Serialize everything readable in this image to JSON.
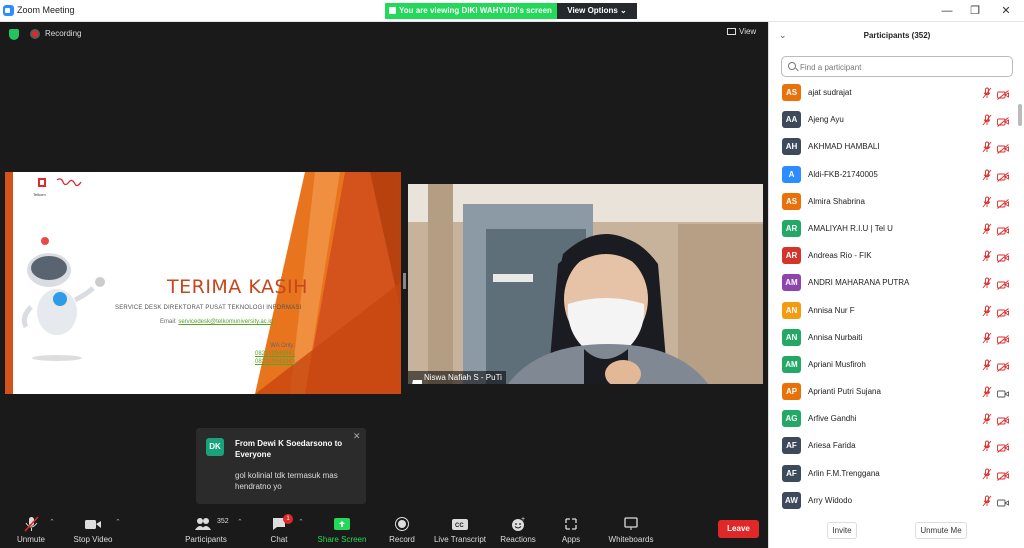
{
  "window": {
    "title": "Zoom Meeting",
    "viewing_banner": "You are viewing DIKI WAHYUDI's screen",
    "view_options": "View Options ⌄"
  },
  "meeting": {
    "recording_label": "Recording",
    "view_label": "View"
  },
  "slide": {
    "title": "TERIMA KASIH",
    "subtitle": "SERVICE DESK DIREKTORAT PUSAT TEKNOLOGI INFORMASI",
    "email_label": "Email:",
    "email": "servicedesk@telkomuniversity.ac.id",
    "wa_label": "WA Only:",
    "wa_numbers": [
      "082319949941",
      "082319949943"
    ],
    "logo_text_1": "Telkom University",
    "logo_text_2": "PuTI"
  },
  "webcam": {
    "name_label": "Niswa Nafiah S - PuTi"
  },
  "chat_toast": {
    "avatar_initials": "DK",
    "from": "From Dewi K Soedarsono to Everyone",
    "message": "gol kolinial tdk termasuk mas hendratno yo",
    "close": "✕"
  },
  "toolbar": {
    "unmute": "Unmute",
    "stop_video": "Stop Video",
    "participants": "Participants",
    "participants_count": "352",
    "chat": "Chat",
    "chat_badge": "1",
    "share_screen": "Share Screen",
    "record": "Record",
    "live_transcript": "Live Transcript",
    "reactions": "Reactions",
    "apps": "Apps",
    "whiteboards": "Whiteboards",
    "leave": "Leave"
  },
  "participants_panel": {
    "title": "Participants (352)",
    "search_placeholder": "Find a participant",
    "invite": "Invite",
    "unmute_me": "Unmute Me",
    "items": [
      {
        "initials": "AS",
        "name": "ajat sudrajat",
        "color": "#e8710a",
        "video_on": false
      },
      {
        "initials": "AA",
        "name": "Ajeng Ayu",
        "color": "#3d4a5c",
        "video_on": false
      },
      {
        "initials": "AH",
        "name": "AKHMAD HAMBALI",
        "color": "#3d4a5c",
        "video_on": false
      },
      {
        "initials": "A",
        "name": "Aldi-FKB-21740005",
        "color": "#2d8cff",
        "video_on": false
      },
      {
        "initials": "AS",
        "name": "Almira Shabrina",
        "color": "#e8710a",
        "video_on": false
      },
      {
        "initials": "AR",
        "name": "AMALIYAH R.I.U | Tel U",
        "color": "#23a866",
        "video_on": false
      },
      {
        "initials": "AR",
        "name": "Andreas Rio - FIK",
        "color": "#d4352b",
        "video_on": false
      },
      {
        "initials": "AM",
        "name": "ANDRI MAHARANA PUTRA",
        "color": "#8e44ad",
        "video_on": false
      },
      {
        "initials": "AN",
        "name": "Annisa Nur F",
        "color": "#f39c12",
        "video_on": false
      },
      {
        "initials": "AN",
        "name": "Annisa Nurbaiti",
        "color": "#23a866",
        "video_on": false
      },
      {
        "initials": "AM",
        "name": "Apriani Musfiroh",
        "color": "#23a866",
        "video_on": false
      },
      {
        "initials": "AP",
        "name": "Aprianti Putri Sujana",
        "color": "#e8710a",
        "video_on": true
      },
      {
        "initials": "AG",
        "name": "Arfive Gandhi",
        "color": "#23a866",
        "video_on": false
      },
      {
        "initials": "AF",
        "name": "Ariesa Farida",
        "color": "#3d4a5c",
        "video_on": false
      },
      {
        "initials": "AF",
        "name": "Arlin F.M.Trenggana",
        "color": "#3d4a5c",
        "video_on": false
      },
      {
        "initials": "AW",
        "name": "Arry Widodo",
        "color": "#3d4a5c",
        "video_on": true
      }
    ]
  }
}
